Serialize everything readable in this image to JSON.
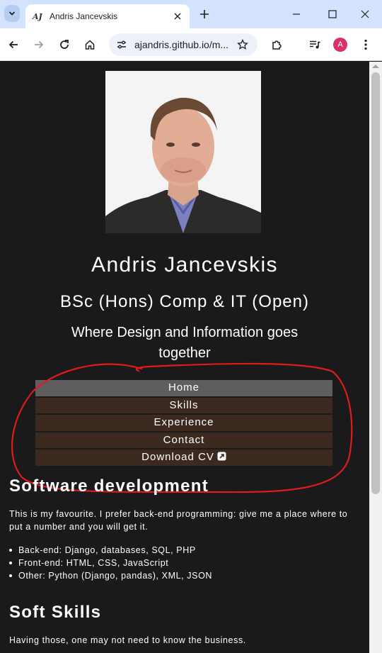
{
  "browser": {
    "tab_title": "Andris Jancevskis",
    "favicon_text": "AJ",
    "url": "ajandris.github.io/m...",
    "profile_initial": "A"
  },
  "profile": {
    "name": "Andris Jancevskis",
    "degree": "BSc (Hons) Comp & IT (Open)",
    "tagline": "Where Design and Information goes together"
  },
  "nav": {
    "items": [
      {
        "label": "Home",
        "active": true
      },
      {
        "label": "Skills"
      },
      {
        "label": "Experience"
      },
      {
        "label": "Contact"
      },
      {
        "label": "Download CV"
      }
    ]
  },
  "annotation": {
    "color": "#e01b1b"
  },
  "sections": {
    "software": {
      "heading": "Software development",
      "intro": "This is my favourite. I prefer back-end programming: give me a place where to put a number and you will get it.",
      "items": [
        "Back-end: Django, databases, SQL, PHP",
        "Front-end: HTML, CSS, JavaScript",
        "Other: Python (Django, pandas), XML, JSON"
      ]
    },
    "soft_skills": {
      "heading": "Soft Skills",
      "intro": "Having those, one may not need to know the business."
    }
  },
  "colors": {
    "page_bg": "#1a191b",
    "nav_bg": "#3c2a20",
    "nav_active_bg": "#5e5e5e",
    "chrome_tabbar": "#d3e3fd"
  }
}
